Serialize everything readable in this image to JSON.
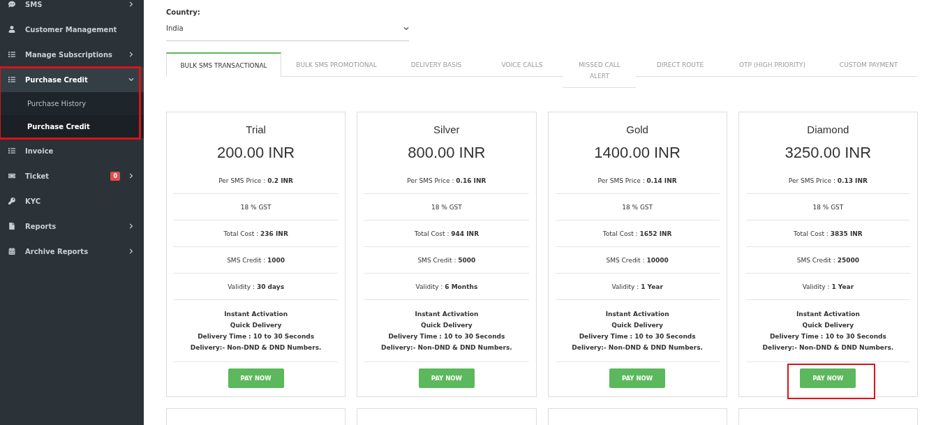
{
  "sidebar": {
    "items": [
      {
        "label": "SMS",
        "has_submenu": true,
        "expanded": false,
        "selected": false
      },
      {
        "label": "Customer Management",
        "has_submenu": false,
        "expanded": false,
        "selected": false
      },
      {
        "label": "Manage Subscriptions",
        "has_submenu": true,
        "expanded": false,
        "selected": false
      },
      {
        "label": "Purchase Credit",
        "has_submenu": true,
        "expanded": true,
        "selected": true,
        "highlighted": true,
        "children": [
          {
            "label": "Purchase History",
            "selected": false
          },
          {
            "label": "Purchase Credit",
            "selected": true
          }
        ]
      },
      {
        "label": "Invoice",
        "has_submenu": false,
        "expanded": false,
        "selected": false
      },
      {
        "label": "Ticket",
        "badge": "0",
        "has_submenu": true,
        "expanded": false,
        "selected": false
      },
      {
        "label": "KYC",
        "has_submenu": false,
        "expanded": false,
        "selected": false
      },
      {
        "label": "Reports",
        "has_submenu": true,
        "expanded": false,
        "selected": false
      },
      {
        "label": "Archive Reports",
        "has_submenu": true,
        "expanded": false,
        "selected": false
      }
    ]
  },
  "country": {
    "label": "Country:",
    "value": "India"
  },
  "tabs": [
    {
      "label": "BULK SMS TRANSACTIONAL",
      "selected": true
    },
    {
      "label": "BULK SMS PROMOTIONAL",
      "selected": false
    },
    {
      "label": "DELIVERY BASIS",
      "selected": false
    },
    {
      "label": "VOICE CALLS",
      "selected": false
    },
    {
      "label": "MISSED CALL ALERT",
      "selected": false
    },
    {
      "label": "DIRECT ROUTE",
      "selected": false
    },
    {
      "label": "OTP (HIGH PRIORITY)",
      "selected": false
    },
    {
      "label": "CUSTOM PAYMENT",
      "selected": false
    }
  ],
  "plans": [
    {
      "name": "Trial",
      "price": "200.00 INR",
      "details": [
        "Per SMS Price : **0.2 INR**",
        "18 % GST",
        "Total Cost : **236 INR**",
        "SMS Credit : **1000**",
        "Validity : **30 days**"
      ],
      "features": [
        "Instant Activation",
        "Quick Delivery",
        "Delivery Time : 10 to 30 Seconds",
        "Delivery:- Non-DND & DND Numbers."
      ],
      "button": "PAY NOW",
      "highlighted": false
    },
    {
      "name": "Silver",
      "price": "800.00 INR",
      "details": [
        "Per SMS Price : **0.16 INR**",
        "18 % GST",
        "Total Cost : **944 INR**",
        "SMS Credit : **5000**",
        "Validity : **6 Months**"
      ],
      "features": [
        "Instant Activation",
        "Quick Delivery",
        "Delivery Time : 10 to 30 Seconds",
        "Delivery:- Non-DND & DND Numbers."
      ],
      "button": "PAY NOW",
      "highlighted": false
    },
    {
      "name": "Gold",
      "price": "1400.00 INR",
      "details": [
        "Per SMS Price : **0.14 INR**",
        "18 % GST",
        "Total Cost : **1652 INR**",
        "SMS Credit : **10000**",
        "Validity : **1 Year**"
      ],
      "features": [
        "Instant Activation",
        "Quick Delivery",
        "Delivery Time : 10 to 30 Seconds",
        "Delivery:- Non-DND & DND Numbers."
      ],
      "button": "PAY NOW",
      "highlighted": false
    },
    {
      "name": "Diamond",
      "price": "3250.00 INR",
      "details": [
        "Per SMS Price : **0.13 INR**",
        "18 % GST",
        "Total Cost : **3835 INR**",
        "SMS Credit : **25000**",
        "Validity : **1 Year**"
      ],
      "features": [
        "Instant Activation",
        "Quick Delivery",
        "Delivery Time : 10 to 30 Seconds",
        "Delivery:- Non-DND & DND Numbers."
      ],
      "button": "PAY NOW",
      "highlighted": true
    }
  ]
}
